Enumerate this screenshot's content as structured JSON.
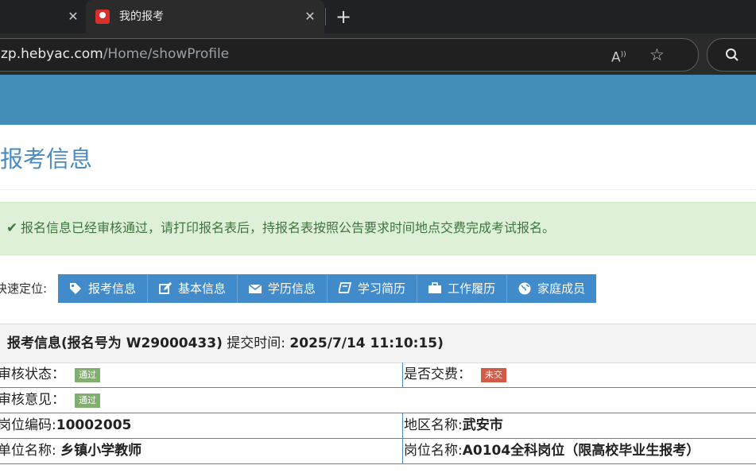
{
  "browser": {
    "active_tab_title": "我的报考",
    "url_host": "zp.hebyac.com",
    "url_path": "/Home/showProfile"
  },
  "page": {
    "title": "报考信息",
    "alert": "报名信息已经审核通过，请打印报名表后，持报名表按照公告要求时间地点交费完成考试报名。",
    "quicknav_label": "快速定位:",
    "quicknav": [
      {
        "label": "报考信息",
        "icon": "tag-icon"
      },
      {
        "label": "基本信息",
        "icon": "edit-icon"
      },
      {
        "label": "学历信息",
        "icon": "envelope-icon"
      },
      {
        "label": "学习简历",
        "icon": "book-icon"
      },
      {
        "label": "工作履历",
        "icon": "briefcase-icon"
      },
      {
        "label": "家庭成员",
        "icon": "globe-icon"
      }
    ],
    "section": {
      "prefix": "报考信息(报名号为 ",
      "reg_no": "W29000433",
      "suffix": ")",
      "time_label": " 提交时间: ",
      "time_value": "2025/7/14 11:10:15)"
    },
    "fields": {
      "review_status_label": "审核状态：",
      "review_status_value": "通过",
      "fee_label": "是否交费：",
      "fee_value": "未交",
      "review_opinion_label": "审核意见：",
      "review_opinion_value": "通过",
      "post_code_label": "岗位编码:",
      "post_code_value": "10002005",
      "region_label": "地区名称:",
      "region_value": "武安市",
      "unit_label": "单位名称: ",
      "unit_value": "乡镇小学教师",
      "post_name_label": "岗位名称:",
      "post_name_value": "A0104全科岗位（限高校毕业生报考）"
    }
  },
  "colors": {
    "banner": "#438eb9",
    "nav_button": "#428bca",
    "badge_pass": "#82af6f",
    "badge_unpaid": "#d15b47"
  }
}
